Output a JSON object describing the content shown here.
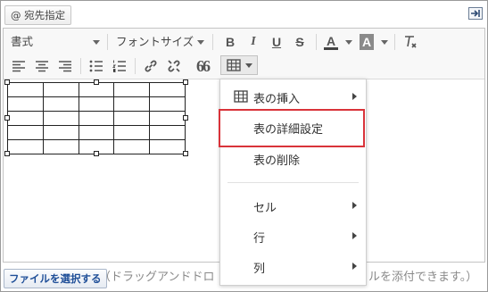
{
  "header": {
    "address_label": "@ 宛先指定"
  },
  "toolbar": {
    "format_combo": "書式",
    "font_size_combo": "フォントサイズ",
    "bold": "B",
    "italic": "I",
    "underline": "U",
    "strike": "S",
    "text_color": "A",
    "bg_color": "A",
    "quote": "66"
  },
  "table_menu": {
    "insert_table": "表の挿入",
    "table_properties": "表の詳細設定",
    "delete_table": "表の削除",
    "cell": "セル",
    "row": "行",
    "column": "列"
  },
  "footer": {
    "file_button": "ファイルを選択する",
    "drop_hint_left": "（ドラッグアンドドロ",
    "drop_hint_right": "ルを添付できます。）"
  },
  "colors": {
    "highlight": "#d9333a",
    "button_text": "#1f4f98",
    "accent_bar": "#5a5a5a"
  }
}
